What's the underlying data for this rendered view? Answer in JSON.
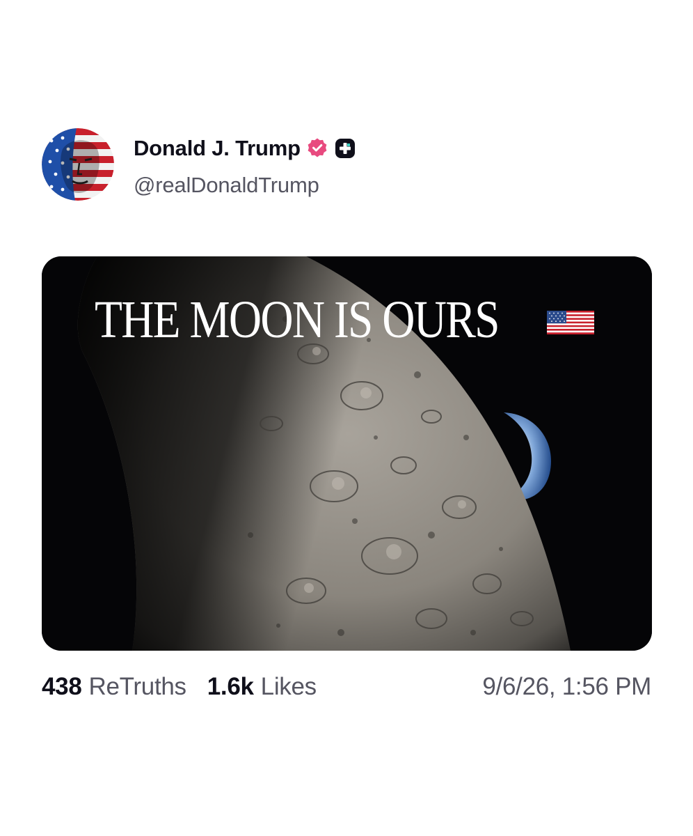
{
  "author": {
    "display_name": "Donald J. Trump",
    "handle": "@realDonaldTrump",
    "verified_icon": "verified-badge-icon",
    "extra_badge_icon": "plus-badge-icon",
    "avatar_icon": "avatar-flag-portrait"
  },
  "media": {
    "headline": "THE MOON IS OURS",
    "flag_icon": "us-flag-icon",
    "scene": "moon-surface-with-earthrise"
  },
  "stats": {
    "retruths_count": "438",
    "retruths_label": "ReTruths",
    "likes_count": "1.6k",
    "likes_label": "Likes"
  },
  "timestamp": "9/6/26, 1:56 PM",
  "colors": {
    "verified_pink": "#e84a7f",
    "text_primary": "#0f0f1a",
    "text_secondary": "#555561",
    "media_background": "#050507"
  }
}
